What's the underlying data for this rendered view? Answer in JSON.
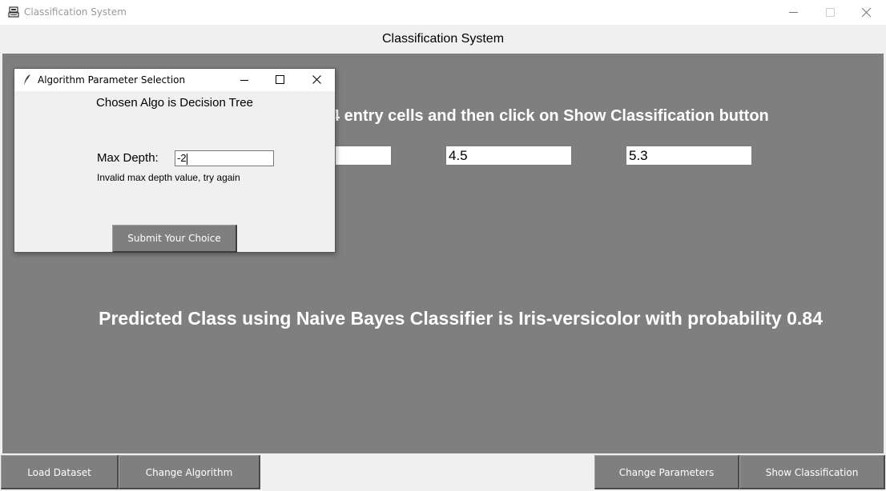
{
  "window": {
    "title": "Classification System",
    "icon": "app-icon"
  },
  "header": {
    "label": "Classification System"
  },
  "main": {
    "instructions_visible": "4 entry cells and then click on Show Classification button",
    "entries": [
      "",
      "4.5",
      "5.3"
    ],
    "prediction": "Predicted Class using Naive Bayes Classifier is Iris-versicolor with probability 0.84"
  },
  "bottom_buttons": {
    "load_dataset": "Load Dataset",
    "change_algorithm": "Change Algorithm",
    "change_parameters": "Change Parameters",
    "show_classification": "Show Classification"
  },
  "dialog": {
    "title": "Algorithm Parameter Selection",
    "icon": "feather-icon",
    "chosen_algo": "Chosen Algo is Decision Tree",
    "max_depth_label": "Max Depth:",
    "max_depth_value": "-2",
    "error_message": "Invalid max depth value, try again",
    "submit_label": "Submit Your Choice"
  },
  "colors": {
    "canvas": "#7f7f7f",
    "button": "#7f7f7f",
    "text_on_canvas": "#ffffff"
  }
}
